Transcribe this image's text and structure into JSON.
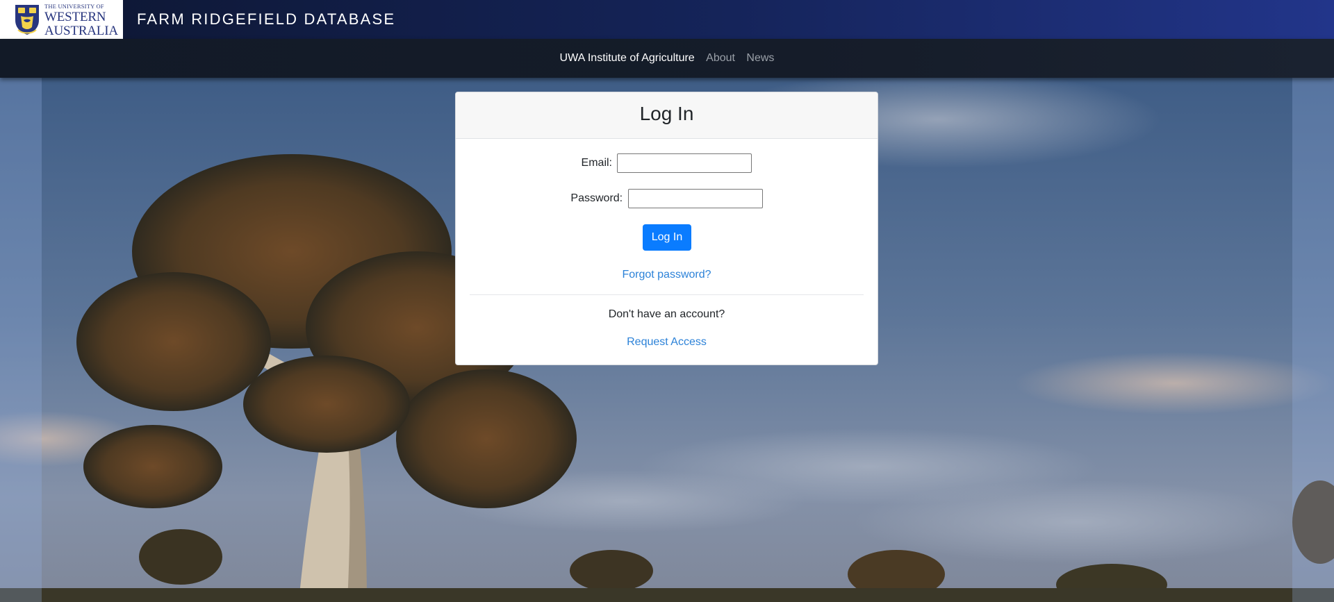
{
  "header": {
    "logo_text_small": "THE UNIVERSITY OF",
    "logo_text_line1": "WESTERN",
    "logo_text_line2": "AUSTRALIA",
    "site_title": "FARM RIDGEFIELD DATABASE"
  },
  "nav": {
    "brand": "UWA Institute of Agriculture",
    "links": [
      "About",
      "News"
    ]
  },
  "login": {
    "title": "Log In",
    "email_label": "Email:",
    "email_value": "",
    "password_label": "Password:",
    "password_value": "",
    "submit_label": "Log In",
    "forgot_link": "Forgot password?",
    "no_account_text": "Don't have an account?",
    "request_link": "Request Access"
  },
  "colors": {
    "header_dark": "#0d1630",
    "header_blue": "#22358a",
    "navbar": "#151c29",
    "primary_button": "#0a7cff",
    "link": "#2c82d8",
    "logo_navy": "#27357e"
  },
  "icons": {
    "logo": "uwa-crest-icon",
    "background": "eucalyptus-landscape"
  }
}
